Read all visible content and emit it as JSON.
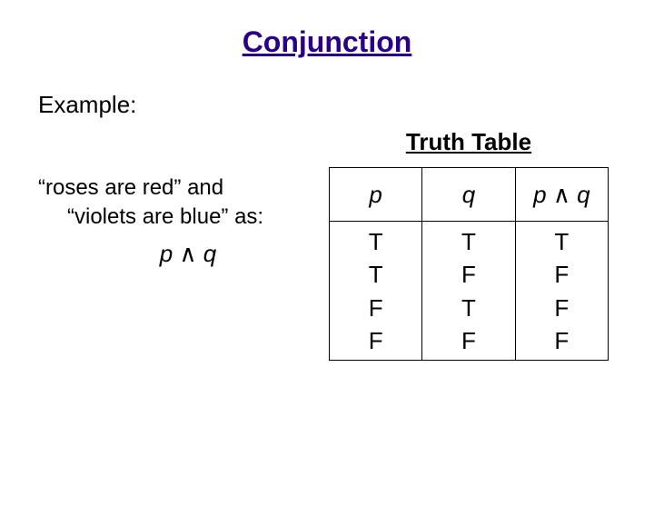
{
  "title": "Conjunction",
  "example_label": "Example:",
  "phrase": {
    "line1_a": "“roses are red” ",
    "line1_b": "and",
    "line2": "“violets are blue” as:"
  },
  "expr": {
    "p": "p",
    "op": "∧",
    "q": "q"
  },
  "truth_table_title": "Truth Table",
  "headers": {
    "p": "p",
    "q": "q",
    "pq_p": "p",
    "pq_op": "∧",
    "pq_q": "q"
  },
  "cols": {
    "p": [
      "T",
      "T",
      "F",
      "F"
    ],
    "q": [
      "T",
      "F",
      "T",
      "F"
    ],
    "pq": [
      "T",
      "F",
      "F",
      "F"
    ]
  },
  "chart_data": {
    "type": "table",
    "title": "Truth Table",
    "columns": [
      "p",
      "q",
      "p ∧ q"
    ],
    "rows": [
      [
        "T",
        "T",
        "T"
      ],
      [
        "T",
        "F",
        "F"
      ],
      [
        "F",
        "T",
        "F"
      ],
      [
        "F",
        "F",
        "F"
      ]
    ]
  }
}
